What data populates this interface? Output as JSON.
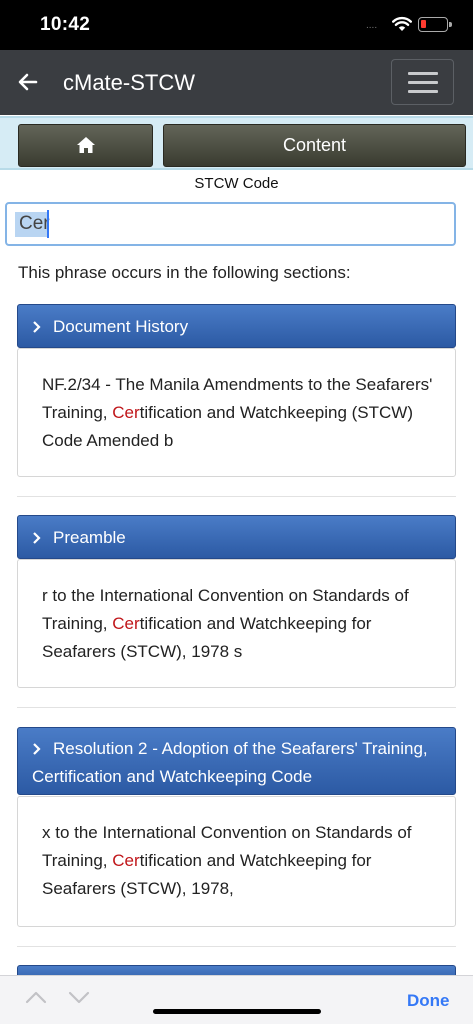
{
  "status_bar": {
    "time": "10:42",
    "signal": "....",
    "battery_color": "#ff3b30"
  },
  "app_bar": {
    "back_glyph": "🡐",
    "title": "cMate-STCW"
  },
  "nav": {
    "home_icon": "home-icon",
    "content_label": "Content"
  },
  "section_title": "STCW Code",
  "search": {
    "value": "Cer"
  },
  "results_intro": "This phrase occurs in the following sections:",
  "results": [
    {
      "title": "Document History",
      "before": "NF.2/34 - The Manila Amendments to the Seafarers' Training, ",
      "hit": "Cer",
      "after": "tification and Watchkeeping (STCW) Code Amended b"
    },
    {
      "title": "Preamble",
      "before": "r to the International Convention on Standards of Training, ",
      "hit": "Cer",
      "after": "tification and Watchkeeping for Seafarers (STCW), 1978 s"
    },
    {
      "title": "Resolution 2 - Adoption of the Seafarers' Training, Certification and Watchkeeping Code",
      "before": "x to the International Convention on Standards of Training, ",
      "hit": "Cer",
      "after": "tification and Watchkeeping for Seafarers (STCW), 1978,"
    }
  ],
  "keyboard_toolbar": {
    "done_label": "Done"
  },
  "colors": {
    "accent": "#3478f6",
    "header_blue": "#2c5aa4",
    "hit_red": "#c0161a"
  }
}
